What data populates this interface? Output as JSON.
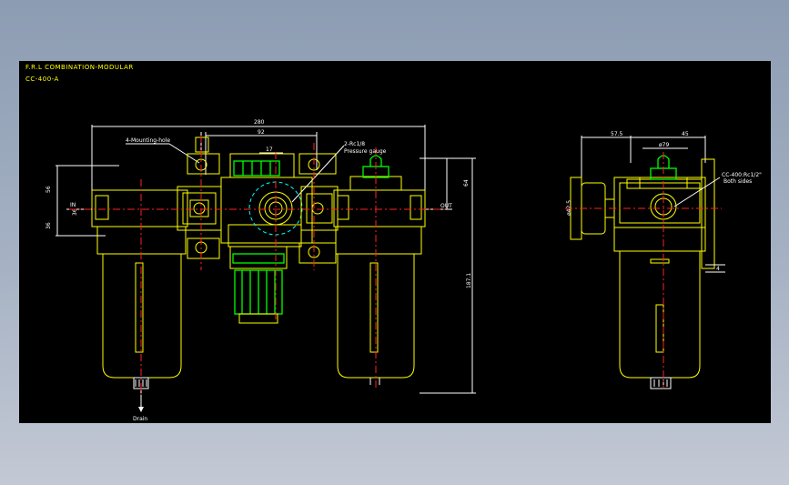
{
  "title": {
    "line1": "F.R.L  COMBINATION-MODULAR",
    "line2": "CC-400-A"
  },
  "dimensions": {
    "d280": "280",
    "d92": "92",
    "d17": "17",
    "d56": "56",
    "d36a": "36",
    "d36b": "36",
    "d64": "64",
    "d1871": "187.1",
    "d575": "57.5",
    "d45": "45",
    "d79": "ø79",
    "d425": "ø42.5",
    "d4": "4"
  },
  "labels": {
    "mounting": "4-Mounting-hole",
    "port_in": "IN",
    "port_out": "OUT",
    "gauge_line1": "2-Rc1/8",
    "gauge_line2": "Pressure gauge",
    "port_note_line1": "CC-400:Rc1/2\"",
    "port_note_line2": "Both sides",
    "drain": "Drain"
  },
  "colors": {
    "background": "#000000",
    "outline": "#ffff00",
    "centerline": "#ff2020",
    "knob": "#00ff00",
    "hidden": "#00ffff",
    "frame": "#8c9cb2"
  }
}
